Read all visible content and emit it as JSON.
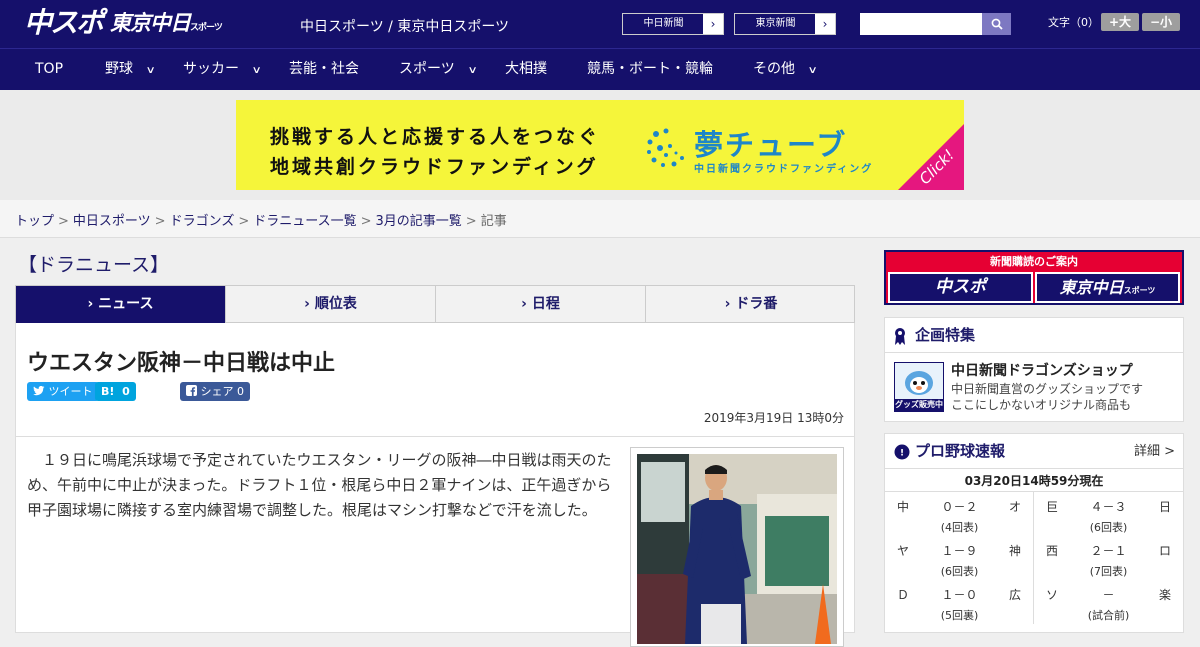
{
  "header": {
    "logo_main": "中スポ",
    "logo_tokyo": "東京中日",
    "logo_tokyo_small": "スポーツ",
    "site_name": "中日スポーツ / 東京中日スポーツ",
    "btn_chunichi": "中日新聞",
    "btn_tokyo": "東京新聞",
    "arrow": "›",
    "search_placeholder": "",
    "font_size_label": "文字（0）",
    "font_larger": "+大",
    "font_smaller": "−小"
  },
  "nav": {
    "items": [
      {
        "label": "TOP",
        "has_menu": false
      },
      {
        "label": "野球",
        "has_menu": true
      },
      {
        "label": "サッカー",
        "has_menu": true
      },
      {
        "label": "芸能・社会",
        "has_menu": false
      },
      {
        "label": "スポーツ",
        "has_menu": true
      },
      {
        "label": "大相撲",
        "has_menu": false
      },
      {
        "label": "競馬・ボート・競輪",
        "has_menu": false
      },
      {
        "label": "その他",
        "has_menu": true
      }
    ],
    "chevron": "∨"
  },
  "ad": {
    "line1": "挑戦する人と応援する人をつなぐ",
    "line2": "地域共創クラウドファンディング",
    "brand": "夢チューブ",
    "brand_sub": "中日新聞クラウドファンディング",
    "click": "Click!",
    "colors": {
      "bg": "#f5f53a",
      "brand": "#1e86c8",
      "corner": "#e5177f"
    }
  },
  "breadcrumb": {
    "items": [
      "トップ",
      "中日スポーツ",
      "ドラゴンズ",
      "ドラニュース一覧",
      "3月の記事一覧"
    ],
    "current": "記事",
    "sep": ">"
  },
  "section_title": "【ドラニュース】",
  "tabs": [
    {
      "label": "ニュース",
      "active": true
    },
    {
      "label": "順位表",
      "active": false
    },
    {
      "label": "日程",
      "active": false
    },
    {
      "label": "ドラ番",
      "active": false
    }
  ],
  "article": {
    "title": "ウエスタン阪神－中日戦は中止",
    "tweet": "ツイート",
    "hatena_icon": "B!",
    "hatena_count": "0",
    "fb_share": "シェア",
    "fb_count": "0",
    "date": "2019年3月19日 13時0分",
    "body": "　１９日に鳴尾浜球場で予定されていたウエスタン・リーグの阪神―中日戦は雨天のため、午前中に中止が決まった。ドラフト１位・根尾ら中日２軍ナインは、正午過ぎから甲子園球場に隣接する室内練習場で調整した。根尾はマシン打撃などで汗を流した。"
  },
  "sidebar": {
    "subscription": {
      "title": "新聞購読のご案内",
      "left": "中スポ",
      "right": "東京中日",
      "right_small": "スポーツ"
    },
    "feature": {
      "heading": "企画特集",
      "shop_title": "中日新聞ドラゴンズショップ",
      "shop_desc1": "中日新聞直営のグッズショップです",
      "shop_desc2": "ここにしかないオリジナル商品も",
      "badge": "グッズ販売中"
    },
    "scores": {
      "heading": "プロ野球速報",
      "detail": "詳細 >",
      "date": "03月20日14時59分現在",
      "left": [
        {
          "home": "中",
          "score": "０－２",
          "away": "オ",
          "status": "(4回表)"
        },
        {
          "home": "ヤ",
          "score": "１－９",
          "away": "神",
          "status": "(6回表)"
        },
        {
          "home": "Ｄ",
          "score": "１－０",
          "away": "広",
          "status": "(5回裏)"
        }
      ],
      "right": [
        {
          "home": "巨",
          "score": "４－３",
          "away": "日",
          "status": "(6回表)"
        },
        {
          "home": "西",
          "score": "２－１",
          "away": "ロ",
          "status": "(7回表)"
        },
        {
          "home": "ソ",
          "score": "－",
          "away": "楽",
          "status": "(試合前)"
        }
      ]
    }
  },
  "colors": {
    "navy": "#15106b",
    "link": "#1f1c6a",
    "twitter": "#1da1f2",
    "hatena": "#00a4de",
    "facebook": "#3b5998"
  }
}
